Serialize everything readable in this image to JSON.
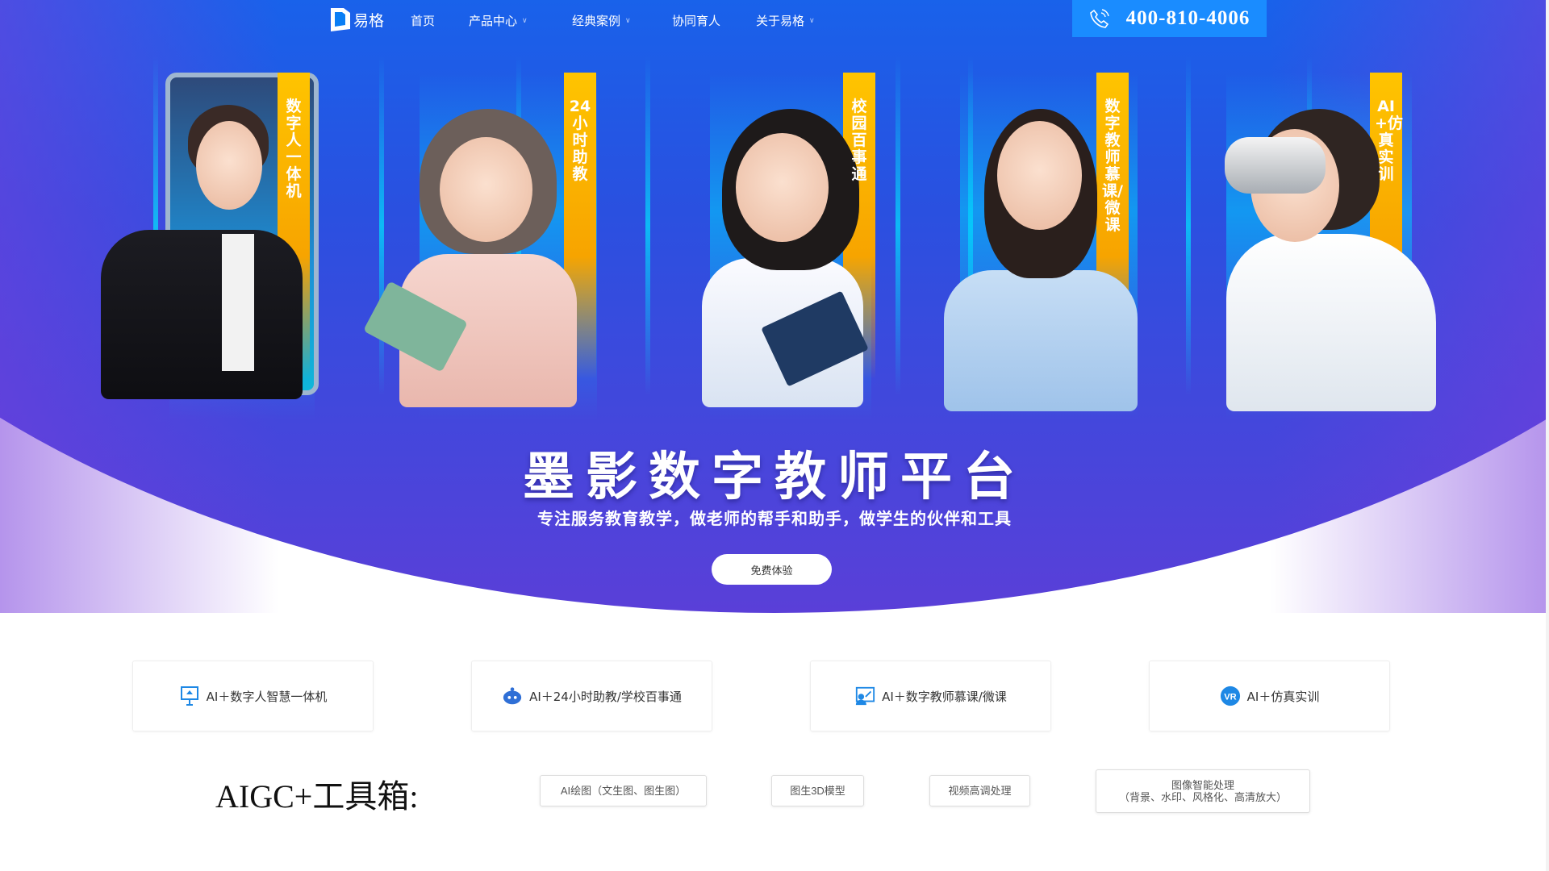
{
  "nav": {
    "logo": "易格",
    "items": [
      {
        "label": "首页",
        "dropdown": false
      },
      {
        "label": "产品中心",
        "dropdown": true
      },
      {
        "label": "经典案例",
        "dropdown": true
      },
      {
        "label": "协同育人",
        "dropdown": false
      },
      {
        "label": "关于易格",
        "dropdown": true
      }
    ],
    "phone": "400-810-4006"
  },
  "hero": {
    "panels": [
      "数字人一体机",
      "24小时助教",
      "校园百事通",
      "数字教师慕课/微课",
      "AI+仿真实训"
    ],
    "title": "墨影数字教师平台",
    "subtitle": "专注服务教育教学，做老师的帮手和助手，做学生的伙伴和工具",
    "cta": "免费体验"
  },
  "cards": [
    {
      "label": "AI＋数字人智慧一体机",
      "icon": "kiosk-icon"
    },
    {
      "label": "AI＋24小时助教/学校百事通",
      "icon": "robot-icon"
    },
    {
      "label": "AI＋数字教师慕课/微课",
      "icon": "teacher-screen-icon"
    },
    {
      "label": "AI＋仿真实训",
      "icon": "vr-icon"
    }
  ],
  "toolbox": {
    "title": "AIGC+工具箱:",
    "tools": [
      "AI绘图（文生图、图生图）",
      "图生3D模型",
      "视频高调处理"
    ],
    "tool4_line1": "图像智能处理",
    "tool4_line2": "（背景、水印、风格化、高清放大）"
  },
  "colors": {
    "nav_blue": "#0a7ef5",
    "accent_yellow": "#ffc400",
    "icon_blue": "#1e88e5"
  }
}
